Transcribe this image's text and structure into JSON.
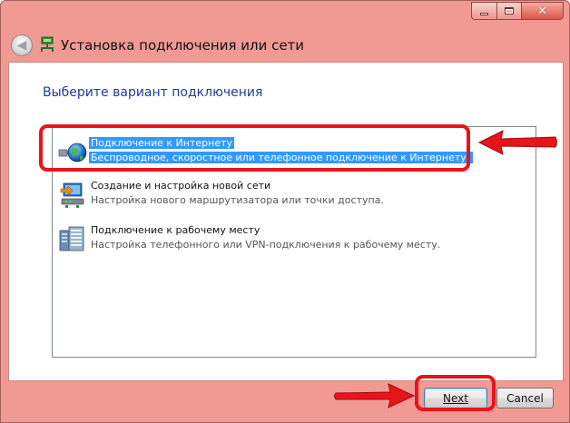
{
  "window": {
    "title": "Установка подключения или сети",
    "accent": "#f19a94"
  },
  "main": {
    "heading": "Выберите вариант подключения",
    "options": [
      {
        "title": "Подключение к Интернету",
        "description": "Беспроводное, скоростное или телефонное подключение к Интернету.",
        "icon": "globe-network-icon",
        "selected": true
      },
      {
        "title": "Создание и настройка новой сети",
        "description": "Настройка нового маршрутизатора или точки доступа.",
        "icon": "router-setup-icon",
        "selected": false
      },
      {
        "title": "Подключение к рабочему месту",
        "description": "Настройка телефонного или VPN-подключения к рабочему месту.",
        "icon": "workplace-server-icon",
        "selected": false
      }
    ]
  },
  "footer": {
    "next_label": "Next",
    "cancel_label": "Cancel"
  },
  "annotations": {
    "highlight_color": "#e8141a"
  }
}
